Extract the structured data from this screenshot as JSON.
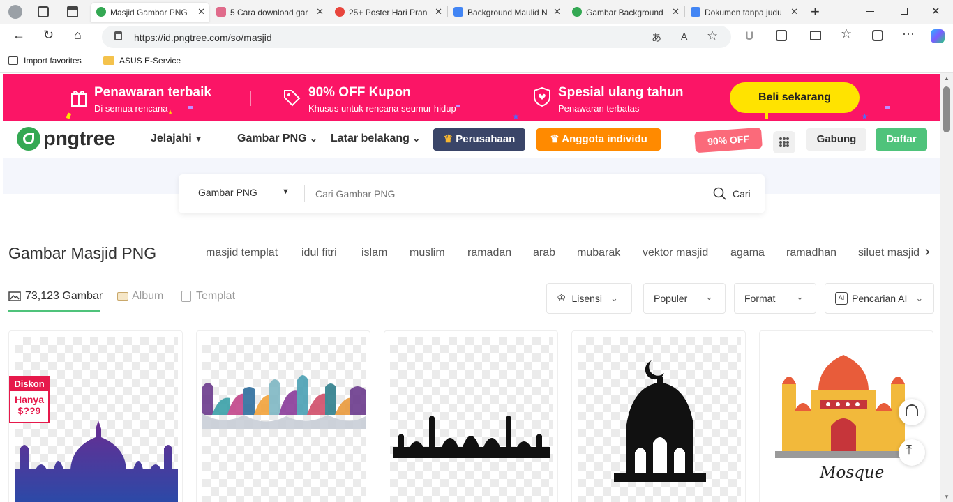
{
  "browser": {
    "tabs": [
      {
        "title": "Masjid Gambar PNG",
        "active": true,
        "favicon_color": "#34a853"
      },
      {
        "title": "5 Cara download gar",
        "active": false,
        "favicon_color": "#e06b8b"
      },
      {
        "title": "25+ Poster Hari Pran",
        "active": false,
        "favicon_color": "#e8453c"
      },
      {
        "title": "Background Maulid N",
        "active": false,
        "favicon_color": "#4285f4"
      },
      {
        "title": "Gambar Background",
        "active": false,
        "favicon_color": "#34a853"
      },
      {
        "title": "Dokumen tanpa judu",
        "active": false,
        "favicon_color": "#4285f4"
      }
    ],
    "url": "https://id.pngtree.com/so/masjid",
    "favorites": [
      {
        "label": "Import favorites",
        "icon": "import-icon"
      },
      {
        "label": "ASUS E-Service",
        "icon": "folder-icon"
      }
    ]
  },
  "promo": {
    "items": [
      {
        "title": "Penawaran terbaik",
        "subtitle": "Di semua rencana",
        "icon": "gift-icon"
      },
      {
        "title": "90% OFF Kupon",
        "subtitle": "Khusus untuk rencana seumur hidup",
        "icon": "tag-icon"
      },
      {
        "title": "Spesial ulang tahun",
        "subtitle": "Penawaran terbatas",
        "icon": "shield-heart-icon"
      }
    ],
    "buy_label": "Beli sekarang",
    "bg_color": "#fb1566",
    "buy_color": "#ffe300"
  },
  "nav": {
    "logo_text": "pngtree",
    "explore": "Jelajahi",
    "png_images": "Gambar PNG",
    "backgrounds": "Latar belakang",
    "enterprise": "Perusahaan",
    "individual": "Anggota individu",
    "discount": "90% OFF",
    "join": "Gabung",
    "register": "Daftar"
  },
  "search": {
    "category": "Gambar PNG",
    "placeholder": "Cari Gambar PNG",
    "button": "Cari"
  },
  "results": {
    "heading": "Gambar Masjid PNG",
    "tags": [
      "masjid templat",
      "idul fitri",
      "islam",
      "muslim",
      "ramadan",
      "arab",
      "mubarak",
      "vektor masjid",
      "agama",
      "ramadhan",
      "siluet masjid"
    ],
    "tabs": [
      {
        "label": "73,123 Gambar",
        "active": true
      },
      {
        "label": "Album",
        "active": false
      },
      {
        "label": "Templat",
        "active": false
      }
    ],
    "filters": [
      {
        "label": "Lisensi",
        "icon": "crown-icon"
      },
      {
        "label": "Populer"
      },
      {
        "label": "Format"
      },
      {
        "label": "Pencarian AI",
        "icon": "ai-icon"
      }
    ],
    "badge": {
      "title": "Diskon",
      "line1": "Hanya",
      "line2": "$??9"
    },
    "mosque_text": "Mosque"
  }
}
